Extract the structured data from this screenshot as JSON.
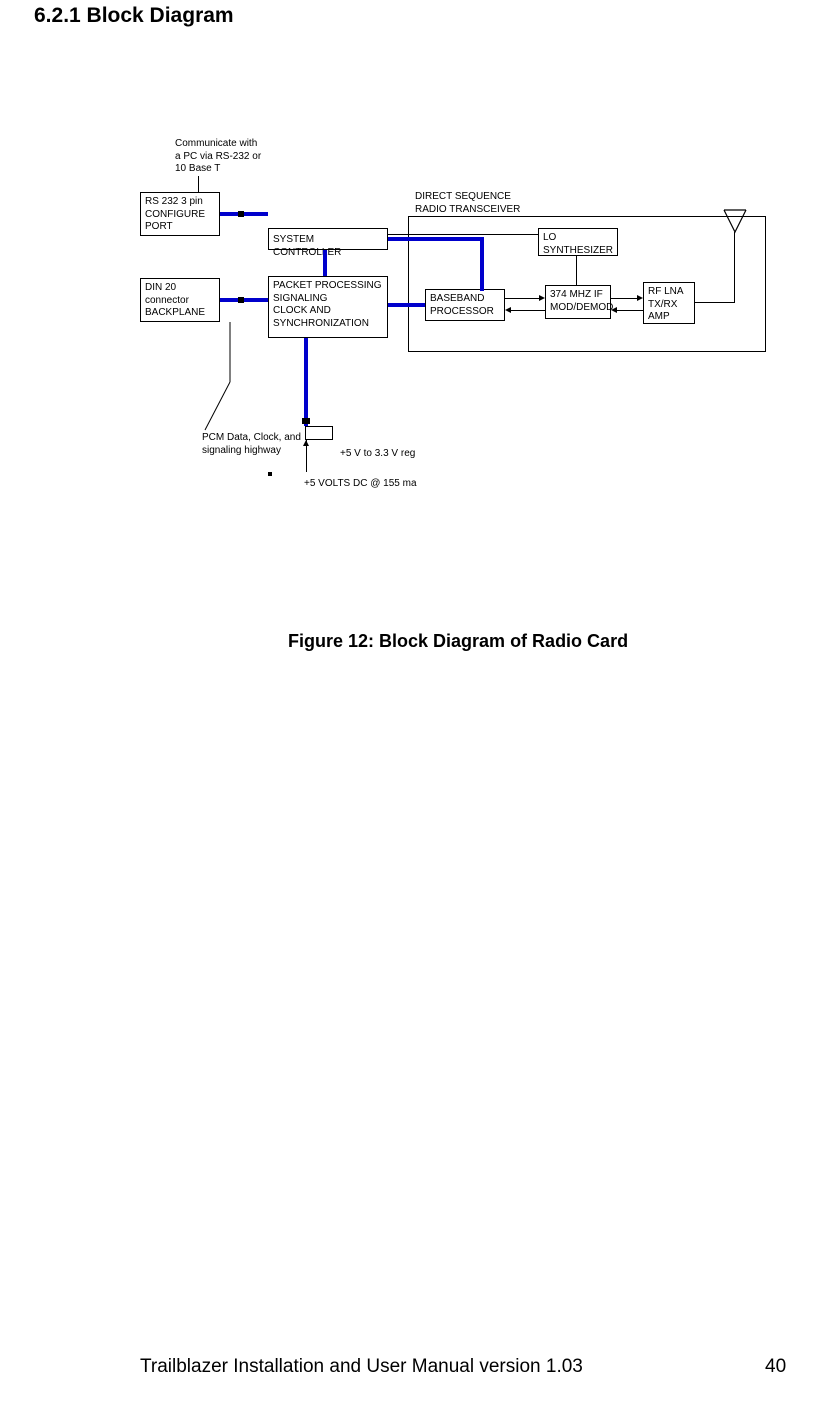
{
  "heading": "6.2.1  Block Diagram",
  "figure_caption": "Figure 12: Block Diagram of Radio Card",
  "footer": {
    "title": "Trailblazer Installation and User Manual version 1.03",
    "page_number": "40"
  },
  "diagram": {
    "note_pc": "Communicate with\na PC via RS-232 or\n10 Base T",
    "note_pcm": "PCM Data, Clock, and\nsignaling highway",
    "transceiver_label": "DIRECT SEQUENCE\nRADIO TRANSCEIVER",
    "reg_label": "+5 V to 3.3 V reg",
    "power_label": "+5 VOLTS DC @ 155 ma",
    "blocks": {
      "configure_port": "RS 232 3 pin\nCONFIGURE\nPORT",
      "backplane": "DIN 20\nconnector\nBACKPLANE",
      "system_controller": "SYSTEM CONTROLLER",
      "packet_proc": "PACKET PROCESSING\nSIGNALING\nCLOCK AND\nSYNCHRONIZATION",
      "baseband": "BASEBAND\nPROCESSOR",
      "if_mod": "374 MHZ IF\nMOD/DEMOD",
      "lo_synth": "LO\nSYNTHESIZER",
      "rf_lna": "RF LNA\nTX/RX\nAMP"
    }
  }
}
